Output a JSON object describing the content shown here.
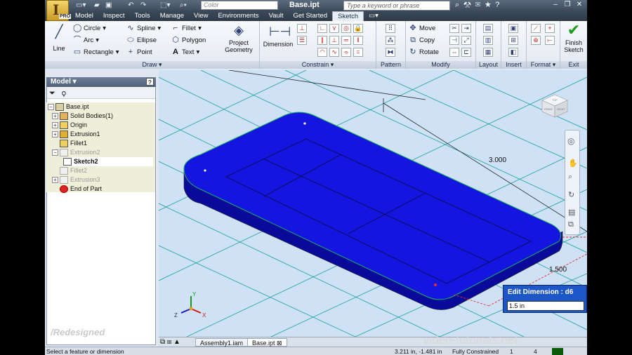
{
  "app": {
    "product_badge": "PRO",
    "doc_title": "Base.ipt",
    "color_placeholder": "Color",
    "search_placeholder": "Type a keyword or phrase"
  },
  "tabs": [
    {
      "label": "Model"
    },
    {
      "label": "Inspect"
    },
    {
      "label": "Tools"
    },
    {
      "label": "Manage"
    },
    {
      "label": "View"
    },
    {
      "label": "Environments"
    },
    {
      "label": "Vault"
    },
    {
      "label": "Get Started"
    },
    {
      "label": "Sketch"
    }
  ],
  "ribbon": {
    "draw": {
      "label": "Draw",
      "line": "Line",
      "circle": "Circle",
      "arc": "Arc",
      "rectangle": "Rectangle",
      "spline": "Spline",
      "ellipse": "Ellipse",
      "point": "Point",
      "fillet": "Fillet",
      "polygon": "Polygon",
      "text": "Text",
      "project_geometry_1": "Project",
      "project_geometry_2": "Geometry"
    },
    "constrain": {
      "label": "Constrain",
      "dimension": "Dimension"
    },
    "pattern": {
      "label": "Pattern"
    },
    "modify": {
      "label": "Modify",
      "move": "Move",
      "copy": "Copy",
      "rotate": "Rotate"
    },
    "layout": {
      "label": "Layout"
    },
    "insert": {
      "label": "Insert"
    },
    "format": {
      "label": "Format"
    },
    "exit": {
      "label": "Exit",
      "finish_1": "Finish",
      "finish_2": "Sketch"
    }
  },
  "browser": {
    "title": "Model",
    "tree": [
      {
        "label": "Base.ipt"
      },
      {
        "label": "Solid Bodies(1)"
      },
      {
        "label": "Origin"
      },
      {
        "label": "Extrusion1"
      },
      {
        "label": "Fillet1"
      },
      {
        "label": "Extrusion2"
      },
      {
        "label": "Sketch2"
      },
      {
        "label": "Fillet2"
      },
      {
        "label": "Extrusion3"
      },
      {
        "label": "End of Part"
      }
    ],
    "watermark": "/Redesigned"
  },
  "viewport": {
    "dim_length": "3.000",
    "dim_width": "1.500",
    "edit_dimension_title": "Edit Dimension : d6",
    "edit_dimension_value": "1.5 in",
    "axis_x": "X",
    "axis_y": "Y",
    "axis_z": "Z",
    "cube_front": "FRONT",
    "cube_right": "RIGHT",
    "cube_top": "TOP"
  },
  "doc_tabs": [
    {
      "label": "Assembly1.iam"
    },
    {
      "label": "Base.ipt"
    }
  ],
  "status": {
    "prompt": "Select a feature or dimension",
    "coords": "3.211 in, -1.481 in",
    "constraint": "Fully Constrained",
    "n1": "1",
    "n2": "4"
  },
  "watermark": "video-tutorials.net",
  "colors": {
    "solid": "#1515e0",
    "viewport": "#cfe1f5",
    "grid": "#1aa0a0"
  }
}
